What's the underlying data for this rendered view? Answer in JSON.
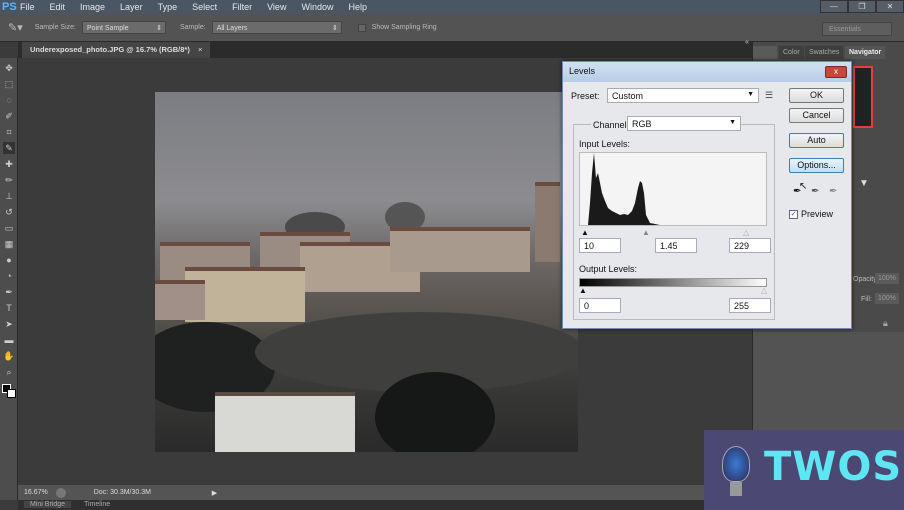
{
  "app": {
    "logo": "PS",
    "menu": [
      "File",
      "Edit",
      "Image",
      "Layer",
      "Type",
      "Select",
      "Filter",
      "View",
      "Window",
      "Help"
    ],
    "window_buttons": [
      "—",
      "❐",
      "✕"
    ]
  },
  "options": {
    "sample_size_label": "Sample Size:",
    "sample_size": "Point Sample",
    "sample_label": "Sample:",
    "sample": "All Layers",
    "show_ring": "Show Sampling Ring",
    "workspace": "Essentials"
  },
  "document": {
    "tab": "Underexposed_photo.JPG @ 16.7% (RGB/8*)",
    "close": "×"
  },
  "status": {
    "zoom": "16.67%",
    "doc": "Doc: 30.3M/30.3M"
  },
  "bottom_tabs": [
    "Mini Bridge",
    "Timeline"
  ],
  "panels": {
    "tabs": [
      "Color",
      "Swatches",
      "Navigator"
    ],
    "opacity_label": "Opacity:",
    "opacity": "100%",
    "fill_label": "Fill:",
    "fill": "100%"
  },
  "levels": {
    "title": "Levels",
    "close": "x",
    "preset_label": "Preset:",
    "preset": "Custom",
    "channel_label": "Channel:",
    "channel": "RGB",
    "input_label": "Input Levels:",
    "input_black": "10",
    "input_gamma": "1.45",
    "input_white": "229",
    "output_label": "Output Levels:",
    "output_black": "0",
    "output_white": "255",
    "buttons": {
      "ok": "OK",
      "cancel": "Cancel",
      "auto": "Auto",
      "options": "Options..."
    },
    "preview_label": "Preview",
    "preview_checked": true
  },
  "watermark": {
    "text": "TWOS",
    "bg": "#4b4873",
    "color": "#5ee6f2"
  }
}
